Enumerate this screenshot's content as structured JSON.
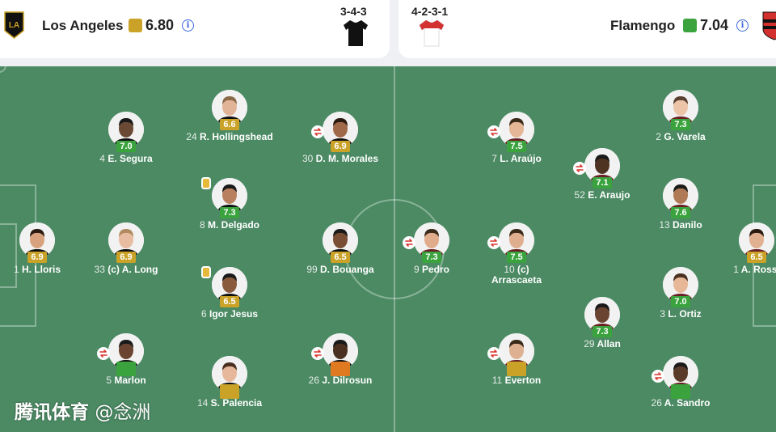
{
  "home": {
    "name": "Los Angeles",
    "rating": "6.80",
    "formation": "3-4-3",
    "rating_color": "#c9a227",
    "kit_color": "#111111"
  },
  "away": {
    "name": "Flamengo",
    "rating": "7.04",
    "formation": "4-2-3-1",
    "rating_color": "#3aa33d",
    "kit_color": "#ffffff",
    "kit_trim": "#d33030"
  },
  "colors": {
    "pitch": "#4b8a63",
    "green": "#3aa33d",
    "gold": "#c9a227",
    "orange": "#e07a21",
    "sub": "#d9342b",
    "card": "#e6b93b"
  },
  "players": [
    {
      "num": "4",
      "name": "E. Segura",
      "rating": "7.0",
      "color": "green",
      "sub": false,
      "card": false,
      "skin": "#6b4a35",
      "hair": "#1a1a1a"
    },
    {
      "num": "24",
      "name": "R. Hollingshead",
      "rating": "6.6",
      "color": "gold",
      "sub": false,
      "card": false,
      "skin": "#e2b497",
      "hair": "#8a6a4a"
    },
    {
      "num": "30",
      "name": "D. M. Morales",
      "rating": "6.9",
      "color": "gold",
      "sub": true,
      "card": false,
      "skin": "#a06a4a",
      "hair": "#2a1a10"
    },
    {
      "num": "8",
      "name": "M. Delgado",
      "rating": "7.3",
      "color": "green",
      "sub": false,
      "card": true,
      "skin": "#b98060",
      "hair": "#1a1a1a"
    },
    {
      "num": "1",
      "name": "H. Lloris",
      "rating": "6.9",
      "color": "gold",
      "sub": false,
      "card": false,
      "skin": "#d9a27e",
      "hair": "#2a1a10"
    },
    {
      "num": "33",
      "name": "(c) A. Long",
      "rating": "6.9",
      "color": "gold",
      "sub": false,
      "card": false,
      "skin": "#e8bca0",
      "hair": "#b08a60"
    },
    {
      "num": "99",
      "name": "D. Bouanga",
      "rating": "6.5",
      "color": "gold",
      "sub": false,
      "card": false,
      "skin": "#7a4e34",
      "hair": "#1a1a1a"
    },
    {
      "num": "6",
      "name": "Igor Jesus",
      "rating": "6.5",
      "color": "gold",
      "sub": false,
      "card": true,
      "skin": "#8a5a3c",
      "hair": "#1a1a1a"
    },
    {
      "num": "5",
      "name": "Marlon",
      "rating": "",
      "color": "green",
      "sub": true,
      "card": false,
      "skin": "#6a4430",
      "hair": "#1a1a1a"
    },
    {
      "num": "26",
      "name": "J. Dilrosun",
      "rating": "",
      "color": "orange",
      "sub": true,
      "card": false,
      "skin": "#4a3020",
      "hair": "#1a1a1a"
    },
    {
      "num": "14",
      "name": "S. Palencia",
      "rating": "",
      "color": "gold",
      "sub": false,
      "card": false,
      "skin": "#e6b79a",
      "hair": "#4a3020"
    },
    {
      "num": "7",
      "name": "L. Araújo",
      "rating": "7.5",
      "color": "green",
      "sub": true,
      "card": false,
      "skin": "#e4b596",
      "hair": "#3a2a1a"
    },
    {
      "num": "2",
      "name": "G. Varela",
      "rating": "7.3",
      "color": "green",
      "sub": false,
      "card": false,
      "skin": "#ecc4a8",
      "hair": "#5a4030"
    },
    {
      "num": "52",
      "name": "E. Araujo",
      "rating": "7.1",
      "color": "green",
      "sub": true,
      "card": false,
      "skin": "#4e3222",
      "hair": "#1a1a1a"
    },
    {
      "num": "13",
      "name": "Danilo",
      "rating": "7.6",
      "color": "green",
      "sub": false,
      "card": false,
      "skin": "#b07a56",
      "hair": "#1a1a1a"
    },
    {
      "num": "9",
      "name": "Pedro",
      "rating": "7.3",
      "color": "green",
      "sub": true,
      "card": false,
      "skin": "#e0ac8c",
      "hair": "#3a2a1a"
    },
    {
      "num": "10",
      "name": "(c)\nArrascaeta",
      "rating": "7.5",
      "color": "green",
      "sub": true,
      "card": false,
      "skin": "#deae8e",
      "hair": "#3a2a1a"
    },
    {
      "num": "1",
      "name": "A. Rossi",
      "rating": "6.5",
      "color": "gold",
      "sub": false,
      "card": false,
      "skin": "#e0b090",
      "hair": "#2a1a10"
    },
    {
      "num": "3",
      "name": "L. Ortiz",
      "rating": "7.0",
      "color": "green",
      "sub": false,
      "card": false,
      "skin": "#e6b898",
      "hair": "#4a3020"
    },
    {
      "num": "29",
      "name": "Allan",
      "rating": "7.3",
      "color": "green",
      "sub": false,
      "card": false,
      "skin": "#6a4430",
      "hair": "#1a1a1a"
    },
    {
      "num": "11",
      "name": "Everton",
      "rating": "",
      "color": "gold",
      "sub": true,
      "card": false,
      "skin": "#ddb092",
      "hair": "#3a2a1a"
    },
    {
      "num": "26",
      "name": "A. Sandro",
      "rating": "",
      "color": "green",
      "sub": true,
      "card": false,
      "skin": "#5a3a28",
      "hair": "#1a1a1a"
    }
  ],
  "watermark": {
    "brand": "腾讯体育",
    "handle": "@念洲"
  }
}
